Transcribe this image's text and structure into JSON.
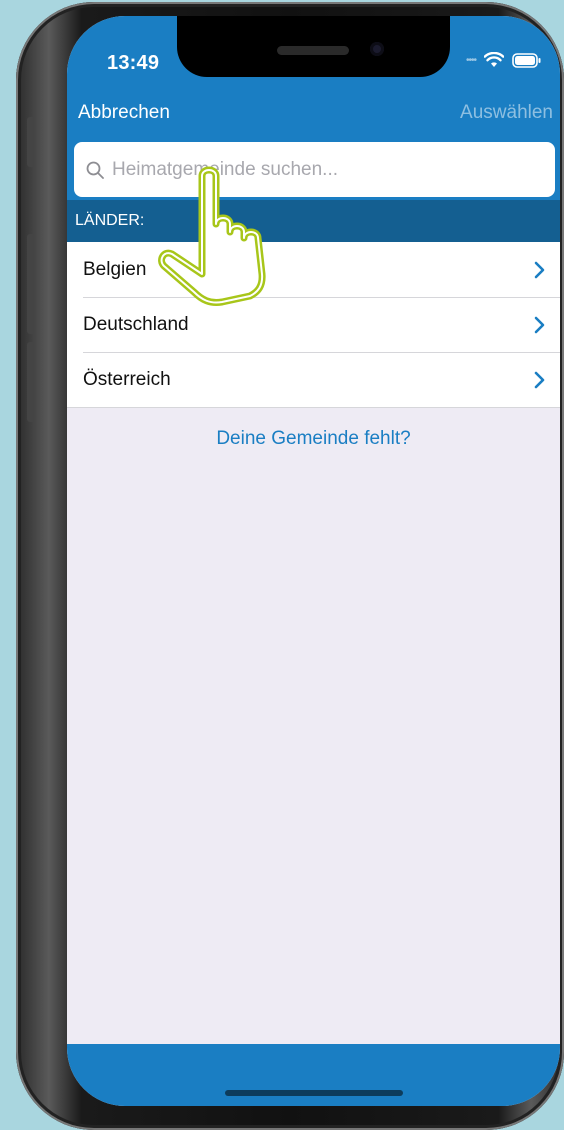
{
  "status_bar": {
    "time": "13:49",
    "signal_icon": "signal-dots-icon",
    "wifi_icon": "wifi-icon",
    "battery_icon": "battery-icon"
  },
  "nav": {
    "cancel_label": "Abbrechen",
    "select_label": "Auswählen"
  },
  "search": {
    "placeholder": "Heimatgemeinde suchen...",
    "value": ""
  },
  "section": {
    "title": "LÄNDER:"
  },
  "countries": [
    {
      "label": "Belgien"
    },
    {
      "label": "Deutschland"
    },
    {
      "label": "Österreich"
    }
  ],
  "footer_link": {
    "label": "Deine Gemeinde fehlt?"
  },
  "colors": {
    "primary": "#1a7ec3",
    "section_header": "#145f91",
    "background": "#eeebf4",
    "stage_background": "#a9d6df",
    "hand_outline": "#a8c61a"
  },
  "overlay": {
    "icon": "pointing-hand-icon"
  }
}
